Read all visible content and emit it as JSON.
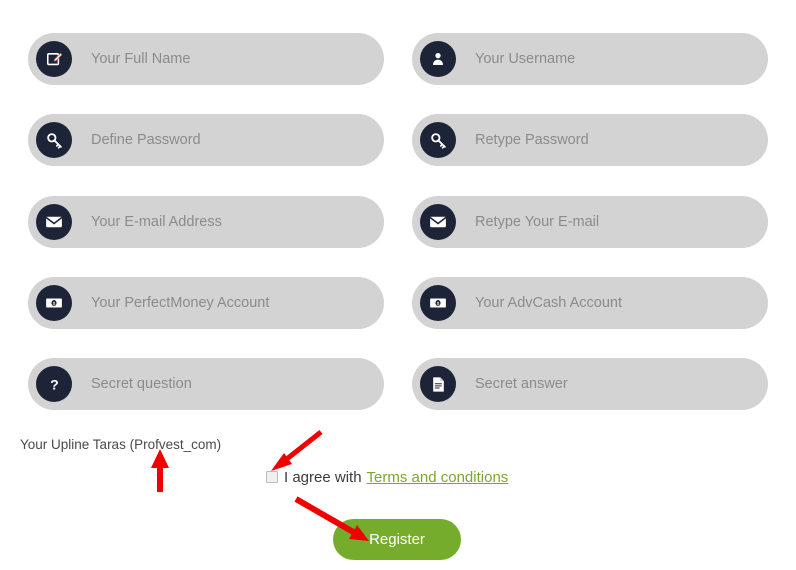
{
  "form": {
    "rows": [
      {
        "left": {
          "icon": "edit-document-icon",
          "placeholder": "Your Full Name"
        },
        "right": {
          "icon": "user-icon",
          "placeholder": "Your Username"
        }
      },
      {
        "left": {
          "icon": "key-icon",
          "placeholder": "Define Password"
        },
        "right": {
          "icon": "key-icon",
          "placeholder": "Retype Password"
        }
      },
      {
        "left": {
          "icon": "envelope-icon",
          "placeholder": "Your E-mail Address"
        },
        "right": {
          "icon": "envelope-icon",
          "placeholder": "Retype Your E-mail"
        }
      },
      {
        "left": {
          "icon": "banknote-icon",
          "placeholder": "Your PerfectMoney Account"
        },
        "right": {
          "icon": "banknote-icon",
          "placeholder": "Your AdvCash Account"
        }
      },
      {
        "left": {
          "icon": "question-mark-icon",
          "placeholder": "Secret question"
        },
        "right": {
          "icon": "file-text-icon",
          "placeholder": "Secret answer"
        }
      }
    ]
  },
  "upline": {
    "text": "Your Upline Taras (Profvest_com)"
  },
  "agreement": {
    "checkbox_checked": false,
    "text": "I agree with",
    "link_label": "Terms and conditions"
  },
  "actions": {
    "register_label": "Register"
  },
  "colors": {
    "field_background": "#d3d3d3",
    "icon_circle": "#1d2438",
    "placeholder_text": "#8b8b8b",
    "register_button": "#76ac2c",
    "link_green": "#7aa72c",
    "annotation_arrow": "#f00000",
    "page_background": "#ffffff"
  },
  "annotations": {
    "arrows": [
      {
        "name": "arrow-to-upline",
        "direction": "up"
      },
      {
        "name": "arrow-to-agree-checkbox",
        "direction": "down-left"
      },
      {
        "name": "arrow-to-register",
        "direction": "down-right"
      }
    ]
  }
}
